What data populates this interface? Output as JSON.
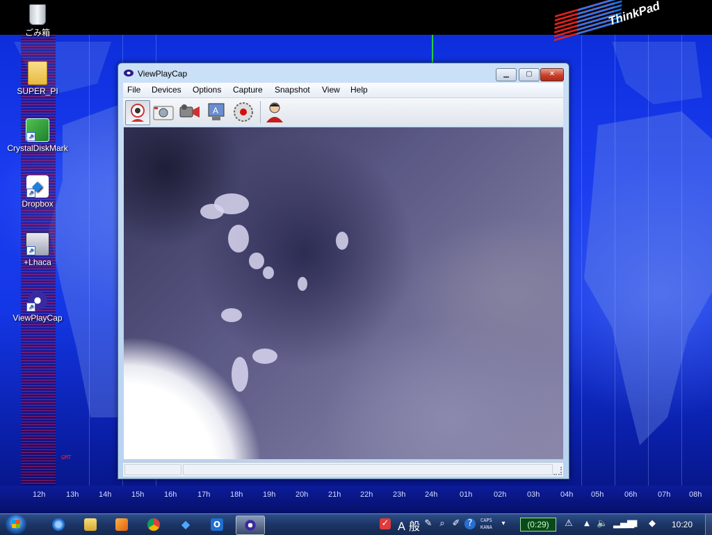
{
  "desktop": {
    "icons": [
      {
        "label": "ごみ箱",
        "icon": "recycle-bin-icon"
      },
      {
        "label": "SUPER_PI",
        "icon": "folder-icon"
      },
      {
        "label": "CrystalDiskMark",
        "icon": "crystaldiskmark-icon"
      },
      {
        "label": "Dropbox",
        "icon": "dropbox-icon"
      },
      {
        "label": "+Lhaca",
        "icon": "lhaca-icon"
      },
      {
        "label": "ViewPlayCap",
        "icon": "viewplaycap-icon"
      }
    ],
    "gmt_label": "GMT",
    "logo_text": "ThinkPad",
    "hours": [
      "12h",
      "13h",
      "14h",
      "15h",
      "16h",
      "17h",
      "18h",
      "19h",
      "20h",
      "21h",
      "22h",
      "23h",
      "24h",
      "01h",
      "02h",
      "03h",
      "04h",
      "05h",
      "06h",
      "07h",
      "08h"
    ]
  },
  "window": {
    "title": "ViewPlayCap",
    "menu": [
      "File",
      "Devices",
      "Options",
      "Capture",
      "Snapshot",
      "View",
      "Help"
    ],
    "toolbar": [
      {
        "icon": "webcam-preview-icon",
        "pressed": true
      },
      {
        "icon": "camera-snapshot-icon",
        "pressed": false
      },
      {
        "icon": "video-capture-icon",
        "pressed": false
      },
      {
        "icon": "video-properties-icon",
        "pressed": false
      },
      {
        "icon": "record-icon",
        "pressed": false
      },
      {
        "icon": "user-icon",
        "pressed": false
      }
    ]
  },
  "taskbar": {
    "apps": [
      "internet-explorer-icon",
      "explorer-icon",
      "media-player-icon",
      "chrome-icon",
      "dropbox-icon",
      "outlook-icon",
      "viewplaycap-icon"
    ],
    "ime": "A 般",
    "caps_line1": "CAPS",
    "caps_line2": "KANA",
    "battery_timer": "(0:29)",
    "clock": "10:20"
  },
  "colors": {
    "taskbar": "#1c3566",
    "desktop_blue": "#1437e6",
    "close_button": "#c8402a",
    "timer_green": "#0a4a1a"
  }
}
